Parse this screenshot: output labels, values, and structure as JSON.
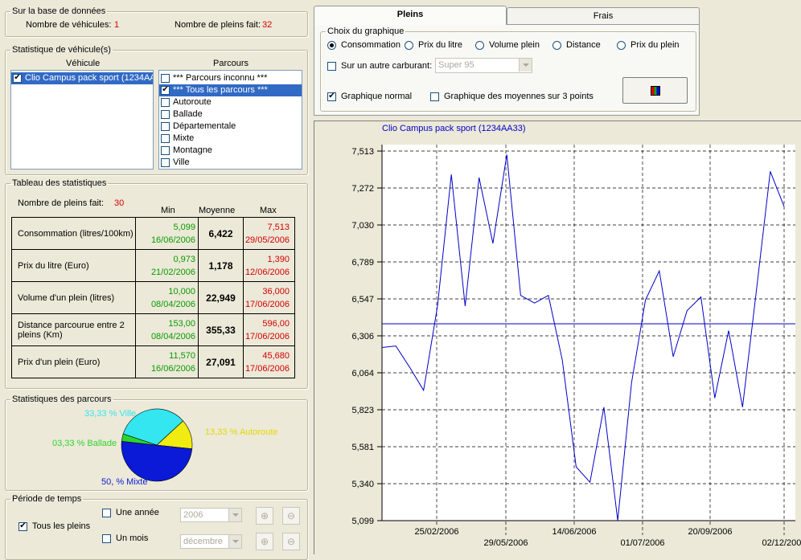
{
  "database": {
    "legend": "Sur la base de données",
    "vehicles_label": "Nombre de véhicules:",
    "vehicles_value": "1",
    "fills_label": "Nombre de pleins fait:",
    "fills_value": "32"
  },
  "vehicle_stats": {
    "legend": "Statistique de véhicule(s)",
    "vehicle_header": "Véhicule",
    "route_header": "Parcours",
    "vehicles": [
      {
        "label": "Clio Campus pack sport (1234AA33)",
        "checked": true
      }
    ],
    "routes": [
      {
        "label": "*** Parcours inconnu ***",
        "checked": false
      },
      {
        "label": "*** Tous les parcours ***",
        "checked": true
      },
      {
        "label": "Autoroute",
        "checked": false
      },
      {
        "label": "Ballade",
        "checked": false
      },
      {
        "label": "Départementale",
        "checked": false
      },
      {
        "label": "Mixte",
        "checked": false
      },
      {
        "label": "Montagne",
        "checked": false
      },
      {
        "label": "Ville",
        "checked": false
      }
    ]
  },
  "stats_table": {
    "legend": "Tableau des statistiques",
    "fills_label": "Nombre de pleins fait:",
    "fills_value": "30",
    "col_min": "Min",
    "col_avg": "Moyenne",
    "col_max": "Max",
    "rows": [
      {
        "label": "Consommation (litres/100km)",
        "min": "5,099",
        "min_date": "16/06/2006",
        "avg": "6,422",
        "max": "7,513",
        "max_date": "29/05/2006"
      },
      {
        "label": "Prix du litre (Euro)",
        "min": "0,973",
        "min_date": "21/02/2006",
        "avg": "1,178",
        "max": "1,390",
        "max_date": "12/06/2006"
      },
      {
        "label": "Volume d'un plein (litres)",
        "min": "10,000",
        "min_date": "08/04/2006",
        "avg": "22,949",
        "max": "36,000",
        "max_date": "17/06/2006"
      },
      {
        "label": "Distance parcourue entre 2 pleins (Km)",
        "min": "153,00",
        "min_date": "08/04/2006",
        "avg": "355,33",
        "max": "596,00",
        "max_date": "17/06/2006"
      },
      {
        "label": "Prix d'un plein (Euro)",
        "min": "11,570",
        "min_date": "16/06/2006",
        "avg": "27,091",
        "max": "45,680",
        "max_date": "17/06/2006"
      }
    ]
  },
  "route_stats": {
    "legend": "Statistiques des parcours",
    "slices": [
      {
        "label": "33,33 % Ville",
        "value": 33.33,
        "color": "#33e6f0"
      },
      {
        "label": "13,33 % Autoroute",
        "value": 13.33,
        "color": "#f0ec12"
      },
      {
        "label": "50, % Mixte",
        "value": 50.0,
        "color": "#0a1ad6"
      },
      {
        "label": "03,33 % Ballade",
        "value": 3.33,
        "color": "#2ed42e"
      }
    ]
  },
  "period": {
    "legend": "Période de temps",
    "all_label": "Tous les pleins",
    "all_checked": true,
    "year_label": "Une année",
    "year_value": "2006",
    "month_label": "Un mois",
    "month_value": "décembre"
  },
  "tabs": {
    "active": "Pleins",
    "other": "Frais"
  },
  "graph_choice": {
    "legend": "Choix du graphique",
    "options": [
      "Consommation",
      "Prix du litre",
      "Volume plein",
      "Distance",
      "Prix du plein"
    ],
    "selected": "Consommation",
    "other_fuel_label": "Sur un autre carburant:",
    "fuel_value": "Super 95",
    "normal_label": "Graphique normal",
    "normal_checked": true,
    "avg3_label": "Graphique des moyennes sur 3 points",
    "avg3_checked": false
  },
  "chart_data": {
    "type": "line",
    "title": "Clio Campus pack sport (1234AA33)",
    "y_ticks": [
      "7,513",
      "7,272",
      "7,030",
      "6,789",
      "6,547",
      "6,306",
      "6,064",
      "5,823",
      "5,581",
      "5,340",
      "5,099"
    ],
    "ylim": [
      5.099,
      7.513
    ],
    "x_ticks_row1": [
      "25/02/2006",
      "14/06/2006",
      "20/09/2006"
    ],
    "x_ticks_row2": [
      "29/05/2006",
      "01/07/2006",
      "02/12/2006"
    ],
    "mean_line": 6.385,
    "grid": true,
    "line_color": "#0000c8",
    "series": [
      {
        "values": [
          6.23,
          6.24,
          6.1,
          5.95,
          6.5,
          7.36,
          6.5,
          7.34,
          6.91,
          7.49,
          6.57,
          6.52,
          6.57,
          6.15,
          5.45,
          5.35,
          5.84,
          5.1,
          6.0,
          6.54,
          6.73,
          6.17,
          6.47,
          6.56,
          5.9,
          6.34,
          5.84,
          6.6,
          7.38,
          7.15
        ]
      }
    ]
  }
}
